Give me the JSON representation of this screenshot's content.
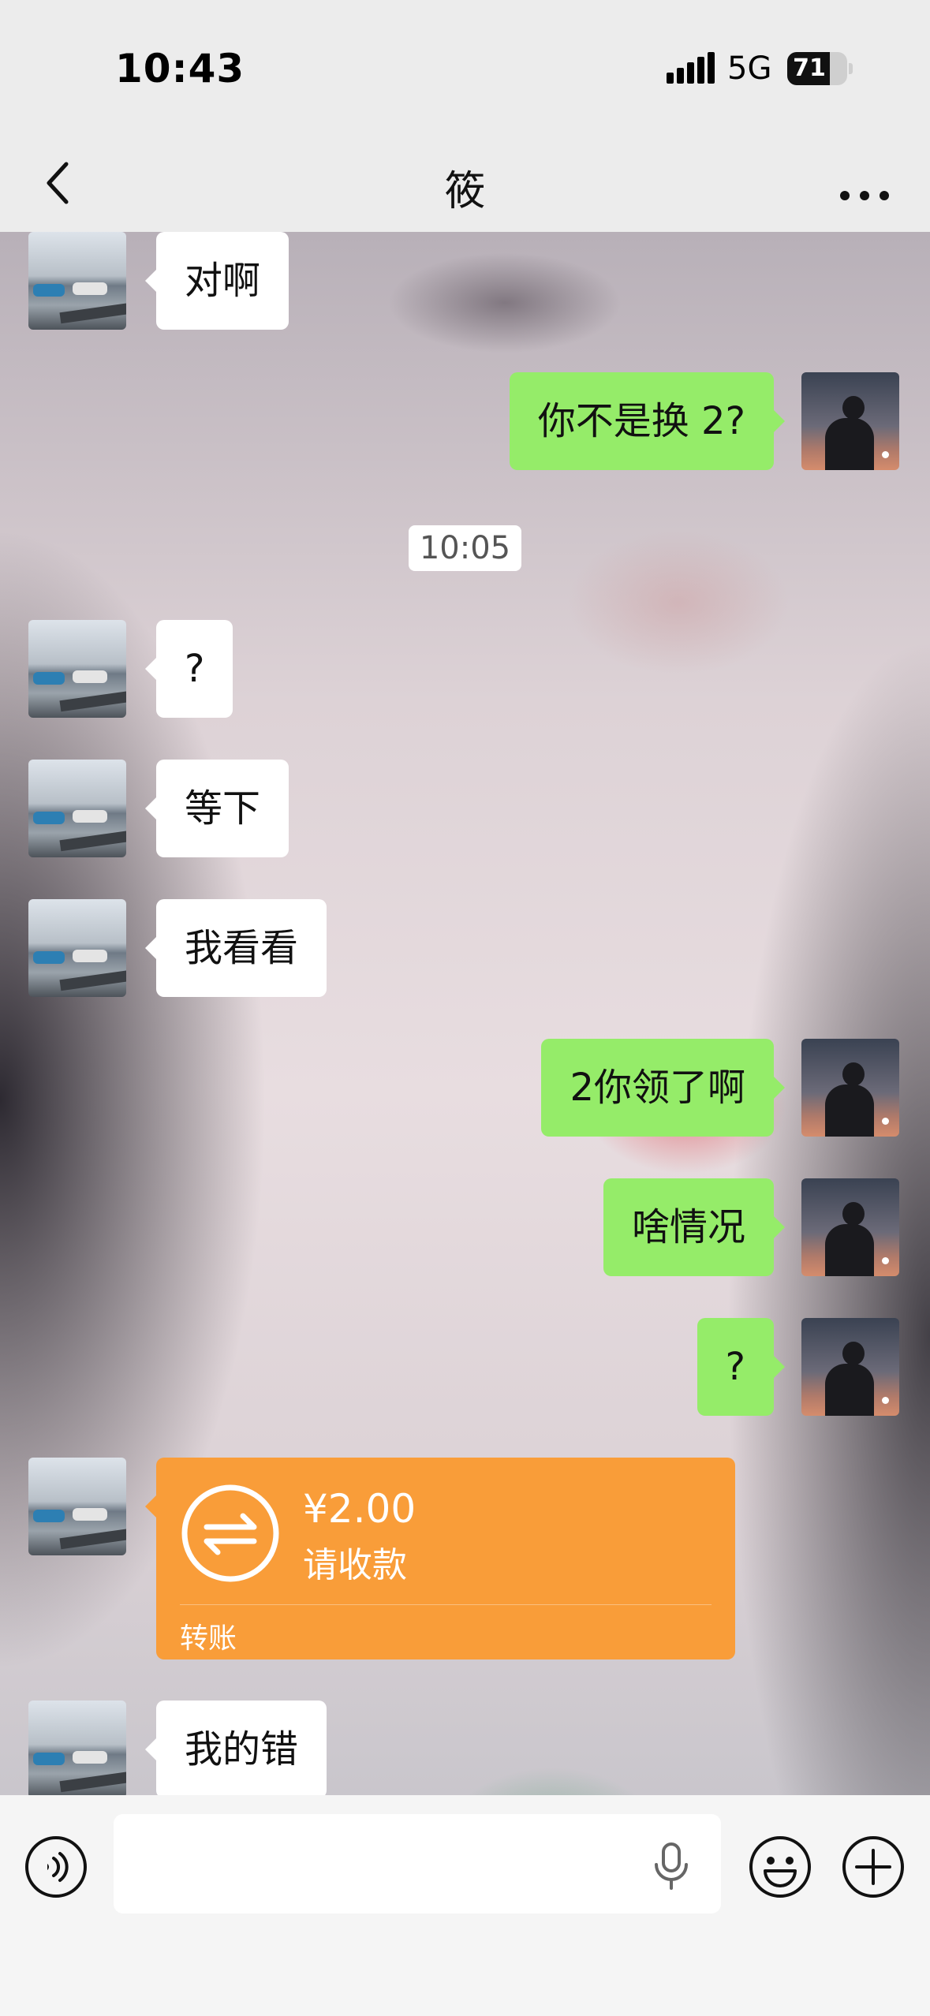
{
  "status_bar": {
    "time": "10:43",
    "network": "5G",
    "battery_percent": "71",
    "battery_level": 0.71
  },
  "nav": {
    "title": "筱"
  },
  "messages": [
    {
      "from": "them",
      "text": "对啊"
    },
    {
      "from": "me",
      "text": "你不是换 2?"
    },
    {
      "timestamp": "10:05"
    },
    {
      "from": "them",
      "text": "?"
    },
    {
      "from": "them",
      "text": "等下"
    },
    {
      "from": "them",
      "text": "我看看"
    },
    {
      "from": "me",
      "text": "2你领了啊"
    },
    {
      "from": "me",
      "text": "啥情况"
    },
    {
      "from": "me",
      "text": "?"
    },
    {
      "from": "them",
      "type": "transfer",
      "amount": "¥2.00",
      "status": "请收款",
      "label": "转账"
    },
    {
      "from": "them",
      "text": "我的错"
    }
  ],
  "colors": {
    "my_bubble": "#95ec69",
    "their_bubble": "#ffffff",
    "transfer_card": "#f99d39"
  },
  "icons": {
    "back": "chevron-left-icon",
    "more": "more-dots-icon",
    "voice": "voice-icon",
    "mic": "mic-icon",
    "emoji": "emoji-icon",
    "plus": "plus-icon",
    "transfer": "transfer-arrows-icon"
  }
}
